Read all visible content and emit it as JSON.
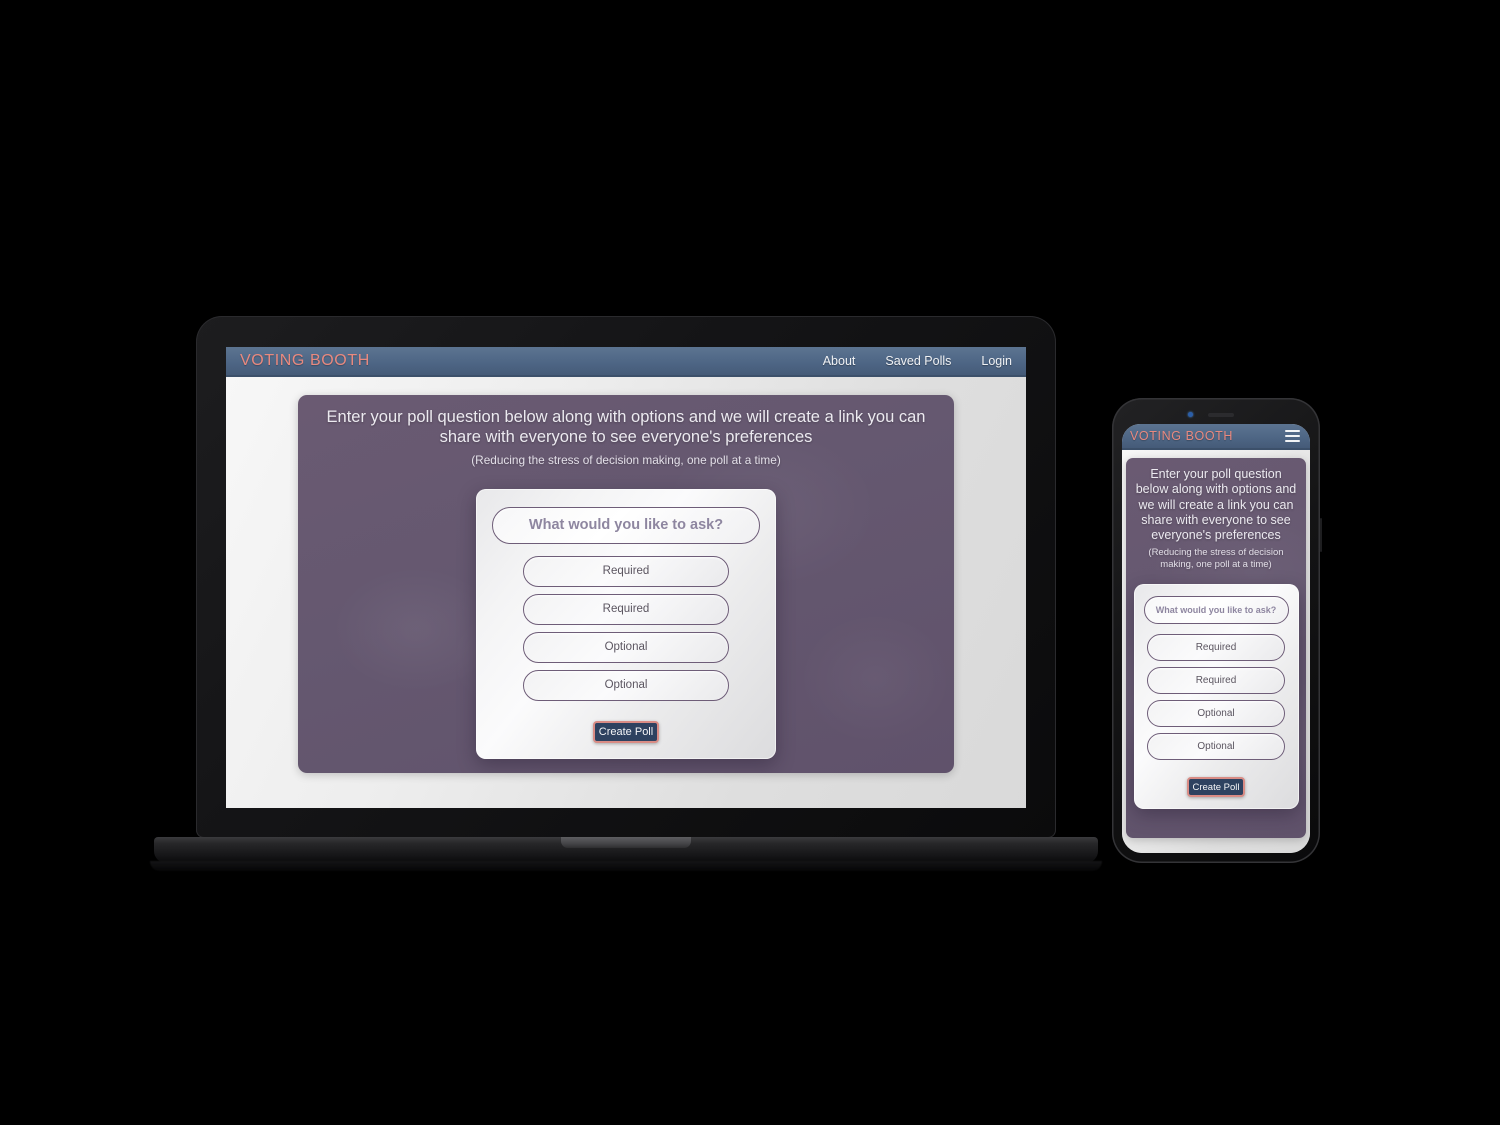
{
  "site": {
    "brand": "VOTING BOOTH",
    "nav": [
      {
        "label": "About"
      },
      {
        "label": "Saved Polls"
      },
      {
        "label": "Login"
      }
    ],
    "menu_icon": "hamburger-menu-icon",
    "hero": {
      "title": "Enter your poll question below along with options and we will create a link you can share with everyone to see everyone's preferences",
      "subtitle": "(Reducing the stress of decision making, one poll at a time)"
    },
    "form": {
      "question_placeholder": "What would you like to ask?",
      "options": [
        {
          "placeholder": "Required"
        },
        {
          "placeholder": "Required"
        },
        {
          "placeholder": "Optional"
        },
        {
          "placeholder": "Optional"
        }
      ],
      "submit_label": "Create Poll"
    }
  },
  "colors": {
    "header_blue": "#4e6685",
    "brand_coral": "#e8897f",
    "hero_purple": "#655870",
    "button_navy": "#2e4260",
    "button_border": "#d98c85",
    "page_grey": "#dedede"
  },
  "devices": {
    "laptop": {
      "name": "laptop-mockup"
    },
    "phone": {
      "name": "phone-mockup"
    }
  }
}
